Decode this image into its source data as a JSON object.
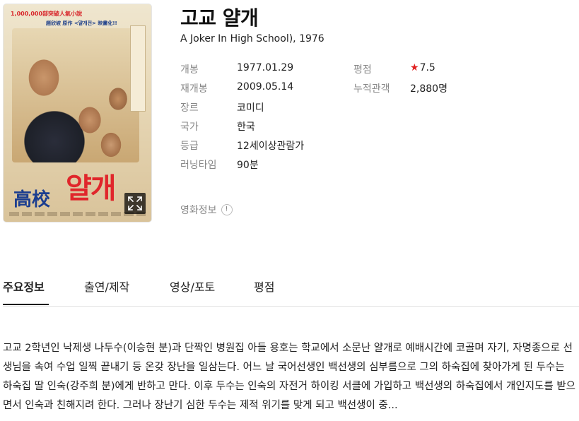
{
  "movie": {
    "title": "고교 얄개",
    "subtitle": "A Joker In High School), 1976"
  },
  "poster": {
    "top_text": "1,000,000部突破人氣小說",
    "sub_text": "趙欣坡 原作 <얄개전> 映畵化!!",
    "logo_hanja": "高校",
    "logo_hangul": "얄개",
    "expand_icon": "expand-icon"
  },
  "details_left": [
    {
      "label": "개봉",
      "value": "1977.01.29"
    },
    {
      "label": "재개봉",
      "value": "2009.05.14"
    },
    {
      "label": "장르",
      "value": "코미디"
    },
    {
      "label": "국가",
      "value": "한국"
    },
    {
      "label": "등급",
      "value": "12세이상관람가"
    },
    {
      "label": "러닝타임",
      "value": "90분"
    }
  ],
  "details_right": [
    {
      "label": "평점",
      "star": "★",
      "value": "7.5"
    },
    {
      "label": "누적관객",
      "value": "2,880명"
    }
  ],
  "movie_info_link": {
    "label": "영화정보",
    "icon_text": "!"
  },
  "tabs": [
    {
      "label": "주요정보",
      "active": true
    },
    {
      "label": "출연/제작",
      "active": false
    },
    {
      "label": "영상/포토",
      "active": false
    },
    {
      "label": "평점",
      "active": false
    }
  ],
  "synopsis": "고교 2학년인 낙제생 나두수(이승현 분)과 단짝인 병원집 아들 용호는 학교에서 소문난 얄개로 예배시간에 코골며 자기, 자명종으로 선생님을 속여 수업 일찍 끝내기 등 온갖 장난을 일삼는다. 어느 날 국어선생인 백선생의 심부름으로 그의 하숙집에 찾아가게 된 두수는 하숙집 딸 인숙(강주희 분)에게 반하고 만다. 이후 두수는 인숙의 자전거 하이킹 서클에 가입하고 백선생의 하숙집에서 개인지도를 받으면서 인숙과 친해지려 한다. 그러나 장난기 심한 두수는 제적 위기를 맞게 되고 백선생이 중...",
  "colors": {
    "accent_star": "#e02020",
    "label_gray": "#888888",
    "text": "#222222"
  }
}
